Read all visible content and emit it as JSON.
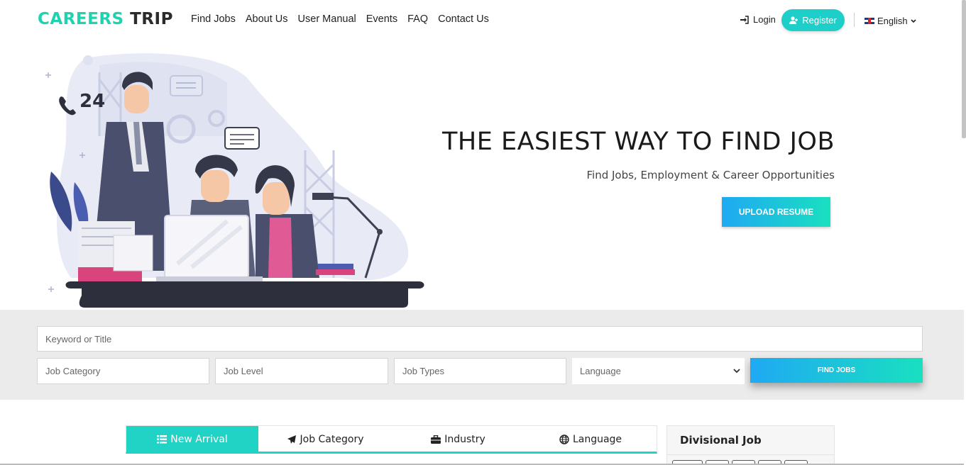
{
  "brand": {
    "part1": "CAREERS",
    "part2": "TRIP"
  },
  "nav": {
    "items": [
      "Find Jobs",
      "About Us",
      "User Manual",
      "Events",
      "FAQ",
      "Contact Us"
    ],
    "login": "Login",
    "register": "Register",
    "language": "English"
  },
  "hero": {
    "title": "THE EASIEST WAY TO FIND JOB",
    "subtitle": "Find Jobs, Employment & Career Opportunities",
    "upload_button": "UPLOAD RESUME",
    "badge_number": "24"
  },
  "search": {
    "keyword_placeholder": "Keyword or Title",
    "job_category_placeholder": "Job Category",
    "job_level_placeholder": "Job Level",
    "job_types_placeholder": "Job Types",
    "language_select": "Language",
    "find_button": "FIND JOBS"
  },
  "tabs": [
    {
      "label": "New Arrival",
      "icon": "list-icon",
      "active": true
    },
    {
      "label": "Job Category",
      "icon": "paper-plane-icon",
      "active": false
    },
    {
      "label": "Industry",
      "icon": "briefcase-icon",
      "active": false
    },
    {
      "label": "Language",
      "icon": "globe-icon",
      "active": false
    }
  ],
  "divisional": {
    "title": "Divisional Job"
  },
  "colors": {
    "accent": "#20d3c4",
    "brand_teal": "#20d3b0",
    "gradient_start": "#1fa9f3",
    "gradient_end": "#19e0c0",
    "search_bg": "#ebebeb"
  }
}
